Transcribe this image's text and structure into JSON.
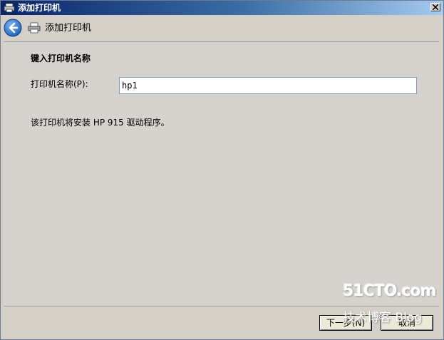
{
  "window": {
    "title": "添加打印机",
    "app_icon": "printer-icon",
    "close_icon": "close-icon"
  },
  "nav": {
    "back_icon": "back-arrow-icon",
    "printer_icon": "printer-icon",
    "title": "添加打印机"
  },
  "main": {
    "heading": "键入打印机名称",
    "printer_name_label": "打印机名称(P):",
    "printer_name_value": "hp1",
    "driver_note": "该打印机将安装 HP 915 驱动程序。"
  },
  "watermark": {
    "text": "51CTO.com",
    "subtext": "技术博客 Blog"
  },
  "footer": {
    "next_label": "下一步(N)",
    "cancel_label": "取消"
  },
  "colors": {
    "titlebar_start": "#0a246a",
    "titlebar_end": "#a6caf0",
    "back_button": "#2a6fc9",
    "dialog_bg": "#d4d0c8"
  }
}
